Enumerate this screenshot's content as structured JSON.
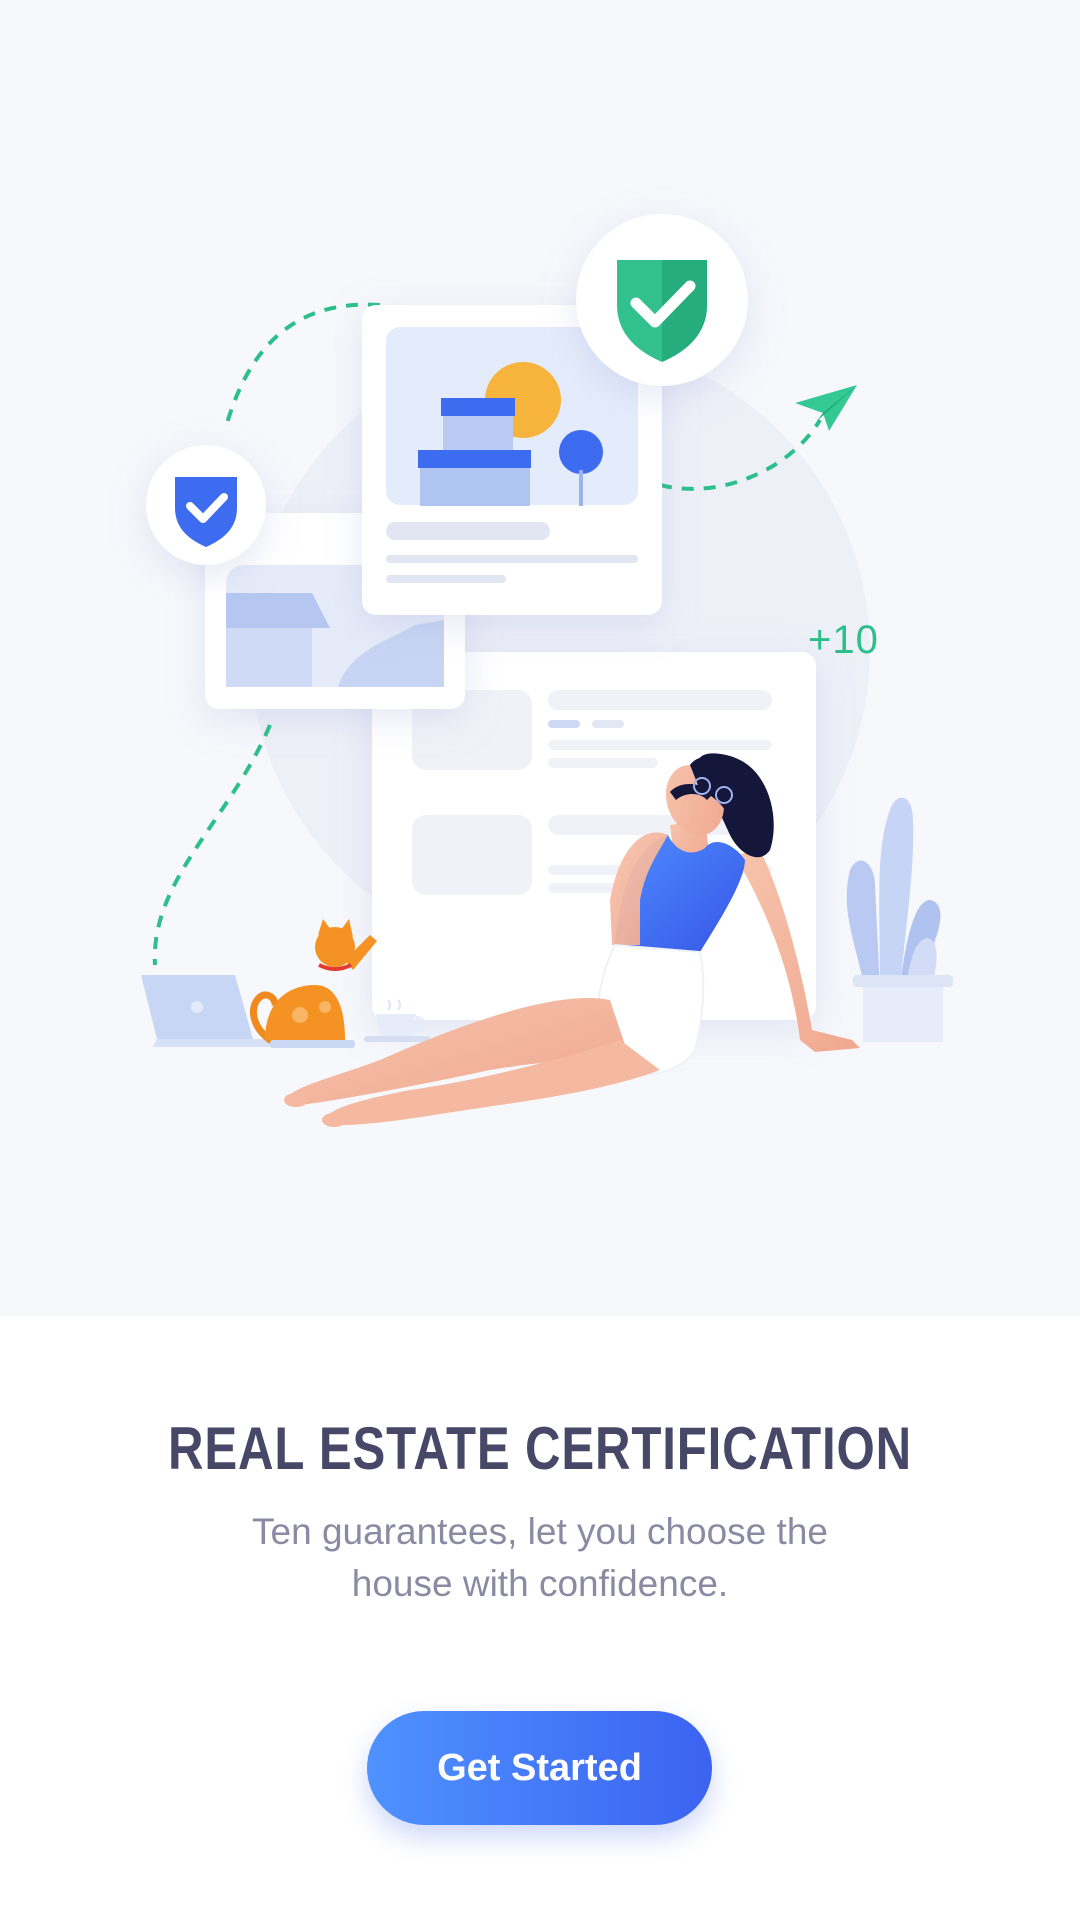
{
  "hero": {
    "badge_text": "+10",
    "illustration": "woman-relaxing-with-real-estate-cards",
    "icons": [
      "shield-check-icon-green",
      "shield-check-icon-blue",
      "paper-plane-icon",
      "house-icon",
      "cat",
      "laptop",
      "coffee-cup",
      "potted-plant"
    ]
  },
  "onboarding": {
    "title": "REAL ESTATE CERTIFICATION",
    "description": "Ten guarantees, let you choose the house with confidence.",
    "cta_label": "Get Started"
  },
  "colors": {
    "title": "#474868",
    "description": "#8a8ba3",
    "cta_start": "#4f92ff",
    "cta_end": "#3b63f0",
    "accent_green": "#2cbf8a",
    "accent_blue": "#3d6cf0",
    "background": "#f7f8fc"
  }
}
